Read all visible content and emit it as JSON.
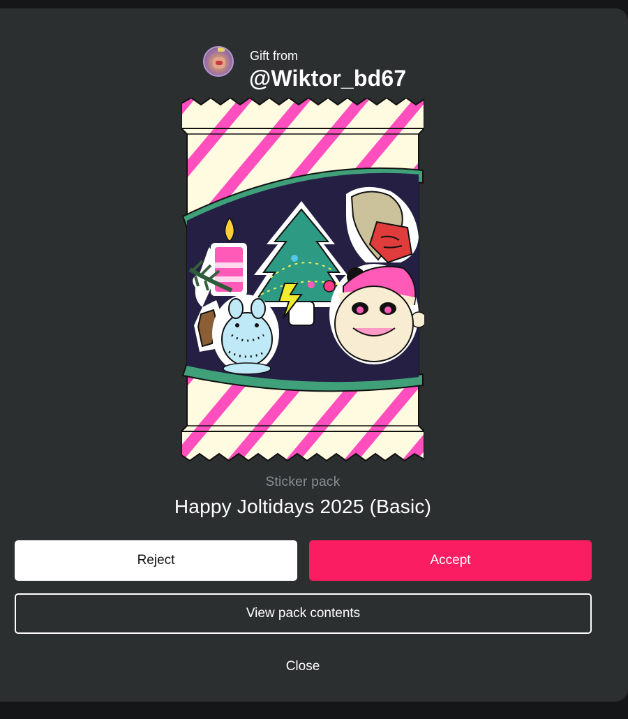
{
  "gift": {
    "from_label": "Gift from",
    "username": "@Wiktor_bd67"
  },
  "pack": {
    "type_label": "Sticker pack",
    "name": "Happy Joltidays 2025 (Basic)"
  },
  "actions": {
    "reject_label": "Reject",
    "accept_label": "Accept",
    "view_label": "View pack contents",
    "close_label": "Close"
  },
  "colors": {
    "background": "#2c2f30",
    "accent": "#fb1d62",
    "wrapper_stripe": "#ff4fbf",
    "wrapper_base": "#fffbe0",
    "window_band": "#3fa07a"
  }
}
